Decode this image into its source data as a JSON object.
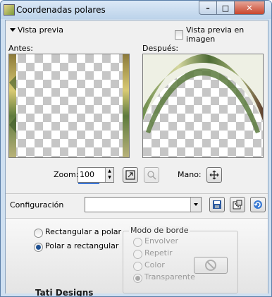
{
  "window": {
    "title": "Coordenadas polares",
    "min": "–",
    "max": "□",
    "close": "✕"
  },
  "preview": {
    "toggle_label": "Vista previa",
    "image_preview_label": "Vista previa en imagen"
  },
  "panels": {
    "before_label": "Antes:",
    "after_label": "Después:"
  },
  "zoom": {
    "label": "Zoom:",
    "value": "100"
  },
  "hand": {
    "label": "Mano:"
  },
  "config": {
    "label": "Configuración",
    "value": ""
  },
  "options": {
    "rect_to_polar": "Rectangular a polar",
    "polar_to_rect": "Polar a rectangular",
    "selected": "polar_to_rect"
  },
  "edge_mode": {
    "title": "Modo de borde",
    "items": [
      "Envolver",
      "Repetir",
      "Color",
      "Transparente"
    ],
    "selected": "Transparente"
  },
  "brand": "Tati Designs",
  "colors": {
    "accent": "#1d4f91",
    "title_bg": "#cfe0f1"
  }
}
